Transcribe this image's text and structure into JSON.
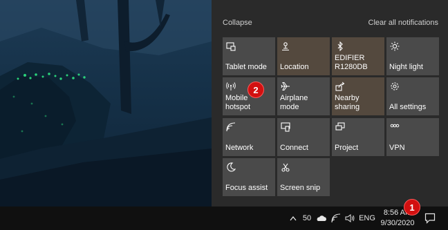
{
  "action_center": {
    "collapse_label": "Collapse",
    "clear_label": "Clear all notifications",
    "tiles": [
      {
        "label": "Tablet mode",
        "icon": "tablet-mode-icon",
        "state": "off"
      },
      {
        "label": "Location",
        "icon": "location-icon",
        "state": "on"
      },
      {
        "label": "EDIFIER\nR1280DB",
        "icon": "bluetooth-icon",
        "state": "on"
      },
      {
        "label": "Night light",
        "icon": "night-light-icon",
        "state": "off"
      },
      {
        "label": "Mobile hotspot",
        "icon": "mobile-hotspot-icon",
        "state": "off"
      },
      {
        "label": "Airplane mode",
        "icon": "airplane-icon",
        "state": "off"
      },
      {
        "label": "Nearby sharing",
        "icon": "nearby-sharing-icon",
        "state": "on"
      },
      {
        "label": "All settings",
        "icon": "gear-icon",
        "state": "off"
      },
      {
        "label": "Network",
        "icon": "network-icon",
        "state": "off"
      },
      {
        "label": "Connect",
        "icon": "connect-icon",
        "state": "off"
      },
      {
        "label": "Project",
        "icon": "project-icon",
        "state": "off"
      },
      {
        "label": "VPN",
        "icon": "vpn-icon",
        "state": "off"
      },
      {
        "label": "Focus assist",
        "icon": "focus-assist-icon",
        "state": "off"
      },
      {
        "label": "Screen snip",
        "icon": "screen-snip-icon",
        "state": "off"
      }
    ]
  },
  "taskbar": {
    "chevron": "^",
    "battery": "50",
    "language": "ENG",
    "time": "8:56 AM",
    "date": "9/30/2020"
  },
  "annotations": {
    "badge_1": "1",
    "badge_2": "2"
  },
  "colors": {
    "tile_on": "#54493e",
    "tile_off": "#4a4a4a",
    "panel": "#2a2a2a",
    "badge": "#d21010"
  }
}
